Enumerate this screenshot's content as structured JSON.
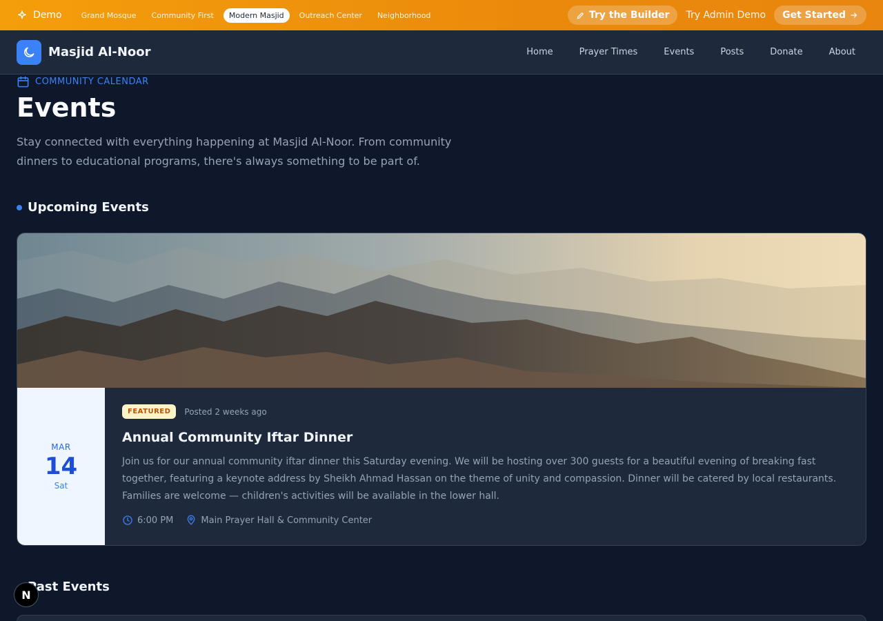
{
  "demo_bar": {
    "label": "Demo",
    "tabs": [
      "Grand Mosque",
      "Community First",
      "Modern Masjid",
      "Outreach Center",
      "Neighborhood"
    ],
    "active_tab": "Modern Masjid",
    "builder_label": "Try the Builder",
    "admin_label": "Try Admin Demo",
    "start_label": "Get Started"
  },
  "header": {
    "site_name": "Masjid Al-Noor",
    "nav": [
      "Home",
      "Prayer Times",
      "Events",
      "Posts",
      "Donate",
      "About"
    ]
  },
  "hero_text": {
    "eyebrow": "COMMUNITY CALENDAR",
    "title": "Events",
    "lead": "Stay connected with everything happening at Masjid Al-Noor. From community dinners to educational programs, there's always something to be part of."
  },
  "upcoming": {
    "heading": "Upcoming Events",
    "event": {
      "month": "MAR",
      "day": "14",
      "weekday": "Sat",
      "badge": "FEATURED",
      "posted": "Posted 2 weeks ago",
      "title": "Annual Community Iftar Dinner",
      "description": "Join us for our annual community iftar dinner this Saturday evening. We will be hosting over 300 guests for a beautiful evening of breaking fast together, featuring a keynote address by Sheikh Ahmad Hassan on the theme of unity and compassion. Dinner will be catered by local restaurants. Families are welcome — children's activities will be available in the lower hall.",
      "time": "6:00 PM",
      "location": "Main Prayer Hall & Community Center"
    }
  },
  "past": {
    "heading": "Past Events"
  },
  "fab_label": "N",
  "icons": {
    "demo": "sparkle-icon",
    "builder": "pencil-icon",
    "start": "arrow-right-icon",
    "logo": "moon-icon",
    "calendar": "calendar-icon",
    "clock": "clock-icon",
    "location": "map-pin-icon"
  },
  "colors": {
    "accent": "#3b82f6",
    "demo_bar": "#f59e0b",
    "background": "#0f172a",
    "surface": "#1e293b"
  }
}
